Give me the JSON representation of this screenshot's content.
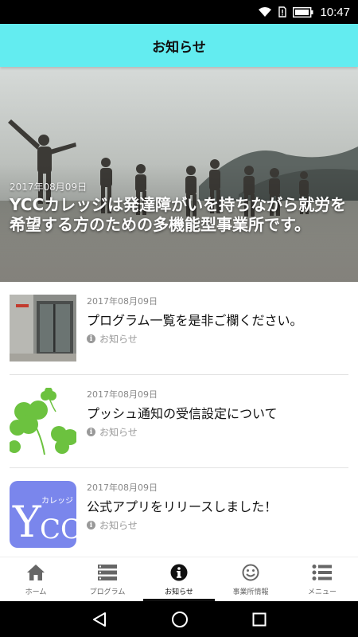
{
  "status_bar": {
    "time": "10:47",
    "icons": [
      "wifi-icon",
      "sim-alert-icon",
      "battery-icon"
    ]
  },
  "header": {
    "title": "お知らせ",
    "color": "#63ecf0"
  },
  "hero": {
    "date": "2017年08月09日",
    "title": "YCCカレッジは発達障がいを持ちながら就労を希望する方のための多機能型事業所です。"
  },
  "news": [
    {
      "date": "2017年08月09日",
      "title": "プログラム一覧を是非ご欄ください。",
      "category": "お知らせ",
      "thumbnail": "building-entrance-photo"
    },
    {
      "date": "2017年08月09日",
      "title": "プッシュ通知の受信設定について",
      "category": "お知らせ",
      "thumbnail": "clover-illustration"
    },
    {
      "date": "2017年08月09日",
      "title": "公式アプリをリリースしました！",
      "category": "お知らせ",
      "thumbnail": "ycc-logo",
      "logo_text": "YCC",
      "logo_subtext": "カレッジ",
      "logo_color": "#7a86ec"
    }
  ],
  "bottom_nav": {
    "items": [
      {
        "label": "ホーム",
        "icon": "home-icon",
        "active": false
      },
      {
        "label": "プログラム",
        "icon": "list-icon",
        "active": false
      },
      {
        "label": "お知らせ",
        "icon": "info-icon",
        "active": true
      },
      {
        "label": "事業所情報",
        "icon": "smiley-icon",
        "active": false
      },
      {
        "label": "メニュー",
        "icon": "menu-icon",
        "active": false
      }
    ]
  },
  "system_nav": [
    "back-icon",
    "home-circle-icon",
    "recents-icon"
  ]
}
